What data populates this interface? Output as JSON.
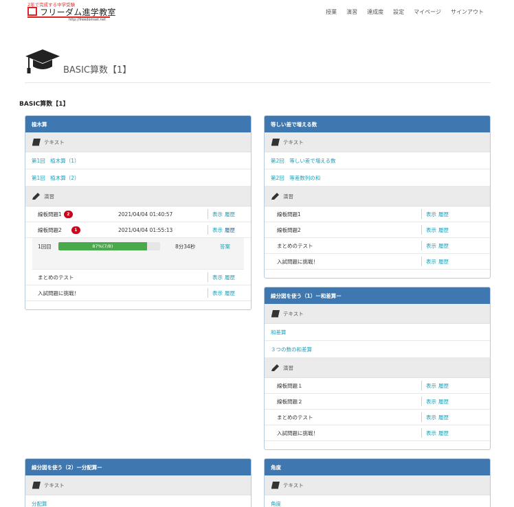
{
  "brand": {
    "tagline": "2年で完成する中学受験",
    "name": "フリーダム進学教室",
    "url": "http://freedomset.net"
  },
  "nav": [
    "授業",
    "演習",
    "達成度",
    "設定",
    "マイページ",
    "サインアウト"
  ],
  "page": {
    "title": "BASIC算数【1】",
    "section_title": "BASIC算数【1】"
  },
  "labels": {
    "text": "テキスト",
    "exercise": "演習",
    "show": "表示",
    "history": "履歴",
    "answer": "答案"
  },
  "panels": [
    {
      "title": "植木算",
      "texts": [
        "第1回　植木算（1）",
        "第1回　植木算（2）"
      ],
      "exercises": [
        {
          "name": "線板問題1",
          "badge": "2",
          "date": "2021/04/04 01:40:57"
        },
        {
          "name": "線板問題2",
          "badge": "1",
          "date": "2021/04/04 01:55:13"
        },
        {
          "name": "まとめのテスト"
        },
        {
          "name": "入試問題に挑戦！"
        }
      ],
      "progress": {
        "attempt": "1回目",
        "label": "87%(7/8)",
        "fraction": 0.87,
        "time": "8分34秒"
      }
    },
    {
      "title": "等しい差で増える数",
      "texts": [
        "第2回　等しい差で増える数",
        "第2回　等差数列の和"
      ],
      "exercises": [
        {
          "name": "線板問題1"
        },
        {
          "name": "線板問題2"
        },
        {
          "name": "まとめのテスト"
        },
        {
          "name": "入試問題に挑戦！"
        }
      ]
    },
    {
      "title": "線分図を使う（1）ー和差算ー",
      "texts": [
        "和差算",
        "３つの数の和差算"
      ],
      "exercises": [
        {
          "name": "線板問題１"
        },
        {
          "name": "線板問題２"
        },
        {
          "name": "まとめのテスト"
        },
        {
          "name": "入試問題に挑戦！"
        }
      ]
    },
    {
      "title": "線分図を使う（2）ー分配算ー",
      "texts": [
        "分配算"
      ]
    },
    {
      "title": "角度",
      "texts": [
        "角度"
      ]
    }
  ],
  "colors": {
    "panel_header": "#3f78b0",
    "link": "#1a9fb8",
    "badge": "#d0021b",
    "progress": "#4aa94a"
  }
}
